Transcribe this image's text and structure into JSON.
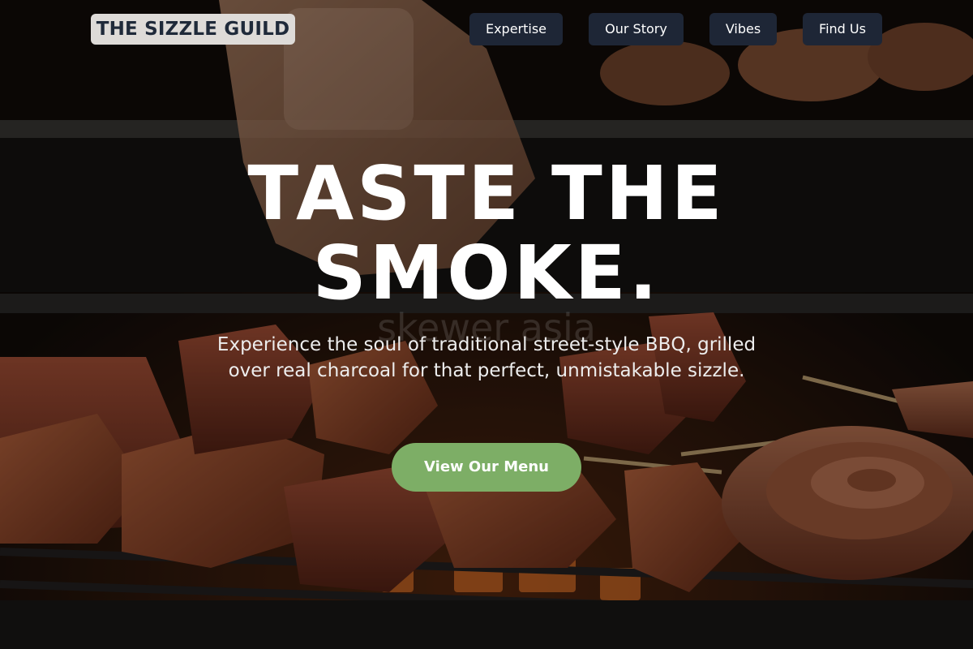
{
  "nav": {
    "logo": "THE SIZZLE GUILD",
    "items": [
      {
        "label": "Expertise"
      },
      {
        "label": "Our Story"
      },
      {
        "label": "Vibes"
      },
      {
        "label": "Find Us"
      }
    ]
  },
  "hero": {
    "headline": "TASTE THE SMOKE.",
    "watermark": "skewer asia",
    "subtitle": "Experience the soul of traditional street-style BBQ, grilled over real charcoal for that perfect, unmistakable sizzle.",
    "cta_label": "View Our Menu"
  },
  "colors": {
    "logo_bg": "#dedbd8",
    "logo_text": "#1f2a3a",
    "nav_bg": "#1e2636",
    "cta_bg": "#7dae66",
    "text": "#ffffff"
  }
}
